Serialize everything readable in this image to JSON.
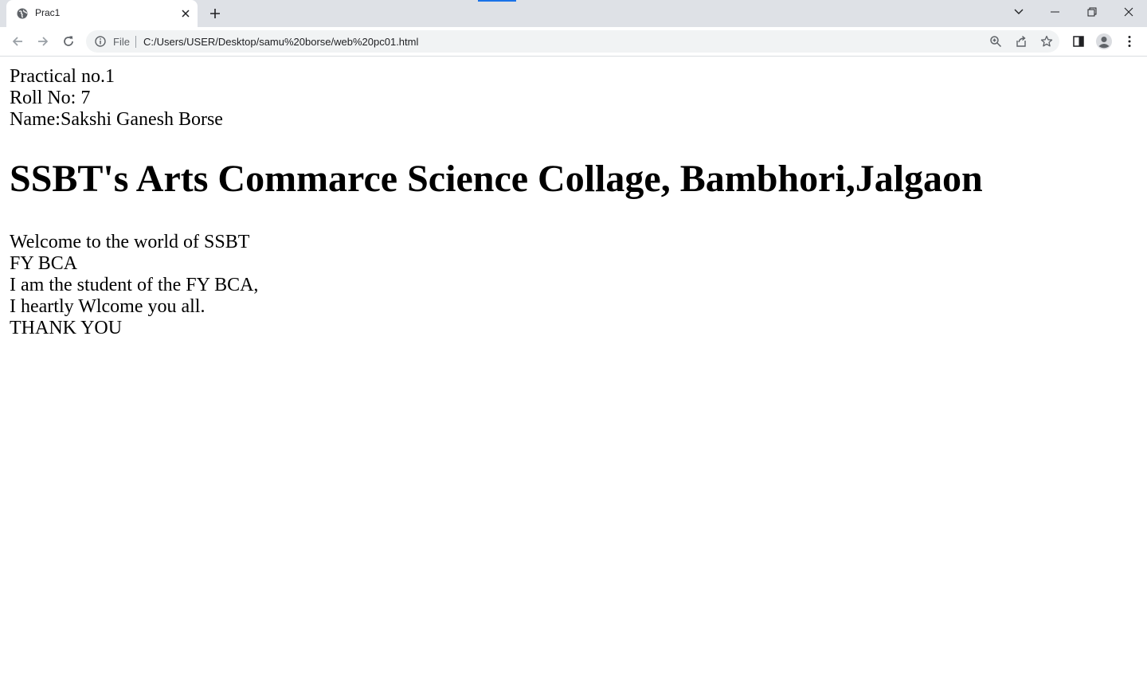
{
  "browser": {
    "tab_title": "Prac1",
    "omnibox": {
      "scheme": "File",
      "url": "C:/Users/USER/Desktop/samu%20borse/web%20pc01.html"
    },
    "icons": [
      "globe-icon",
      "close-icon",
      "plus-icon",
      "chevron-down-icon",
      "minimize-icon",
      "restore-icon",
      "window-close-icon",
      "back-arrow-icon",
      "forward-arrow-icon",
      "reload-icon",
      "info-icon",
      "zoom-icon",
      "share-icon",
      "star-icon",
      "side-panel-icon",
      "profile-icon",
      "more-vert-icon"
    ],
    "colors": {
      "tabstrip": "#dee1e6",
      "omnibox": "#f1f3f4",
      "accent": "#1a73e8"
    }
  },
  "page": {
    "header_lines": [
      "Practical no.1",
      "Roll No: 7",
      "Name:Sakshi Ganesh Borse"
    ],
    "heading": "SSBT's Arts Commarce Science Collage, Bambhori,Jalgaon",
    "body_lines": [
      "Welcome to the world of SSBT",
      "FY BCA",
      "I am the student of the FY BCA,",
      "I heartly Wlcome you all.",
      "THANK YOU"
    ]
  }
}
